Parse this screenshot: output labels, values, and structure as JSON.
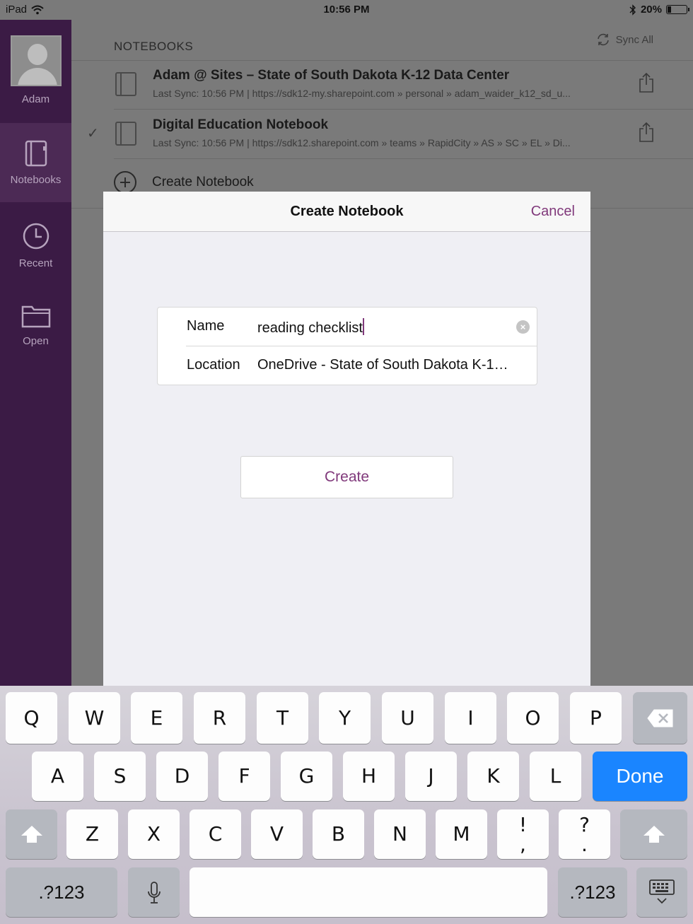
{
  "status_bar": {
    "device": "iPad",
    "time": "10:56 PM",
    "battery": "20%"
  },
  "sidebar": {
    "user_name": "Adam",
    "items": [
      {
        "label": "Notebooks",
        "icon": "notebook-icon",
        "active": true
      },
      {
        "label": "Recent",
        "icon": "clock-icon",
        "active": false
      },
      {
        "label": "Open",
        "icon": "folder-icon",
        "active": false
      }
    ]
  },
  "notebooks": {
    "header": "NOTEBOOKS",
    "sync_all": "Sync All",
    "list": [
      {
        "title": "Adam @ Sites – State of South Dakota K-12 Data Center",
        "subtitle": "Last Sync: 10:56 PM | https://sdk12-my.sharepoint.com » personal » adam_waider_k12_sd_u...",
        "checked": false
      },
      {
        "title": "Digital Education Notebook",
        "subtitle": "Last Sync: 10:56 PM | https://sdk12.sharepoint.com » teams » RapidCity » AS » SC » EL » Di...",
        "checked": true
      }
    ],
    "create_label": "Create Notebook"
  },
  "modal": {
    "title": "Create Notebook",
    "cancel_label": "Cancel",
    "name_label": "Name",
    "name_value": "reading checklist",
    "location_label": "Location",
    "location_value": "OneDrive - State of South Dakota K-1…",
    "create_button": "Create"
  },
  "keyboard": {
    "row1": [
      "Q",
      "W",
      "E",
      "R",
      "T",
      "Y",
      "U",
      "I",
      "O",
      "P"
    ],
    "row2": [
      "A",
      "S",
      "D",
      "F",
      "G",
      "H",
      "J",
      "K",
      "L"
    ],
    "row3": [
      "Z",
      "X",
      "C",
      "V",
      "B",
      "N",
      "M"
    ],
    "exclam": {
      "top": "!",
      "bottom": ","
    },
    "question": {
      "top": "?",
      "bottom": "."
    },
    "done_label": "Done",
    "numbers_label": ".?123"
  },
  "colors": {
    "accent": "#80397b",
    "sidebar": "#3b1b45",
    "done_key": "#1a85ff"
  }
}
